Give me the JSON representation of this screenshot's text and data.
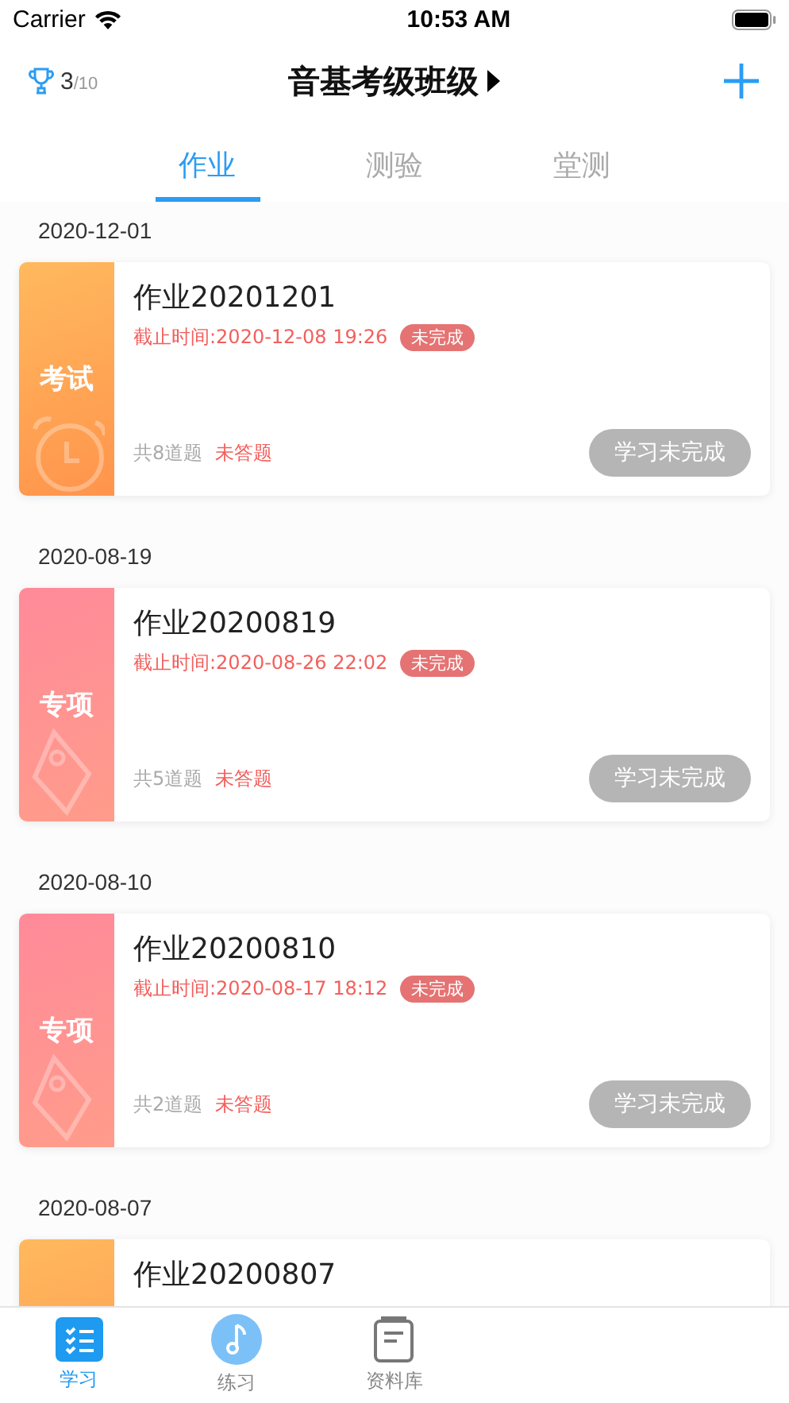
{
  "status_bar": {
    "carrier": "Carrier",
    "time": "10:53 AM"
  },
  "header": {
    "trophy_count": "3",
    "trophy_total": "/10",
    "title": "音基考级班级"
  },
  "tabs": [
    {
      "label": "作业",
      "selected": true
    },
    {
      "label": "测验",
      "selected": false
    },
    {
      "label": "堂测",
      "selected": false
    }
  ],
  "groups": [
    {
      "date": "2020-12-01",
      "card": {
        "kind": "exam",
        "tag": "考试",
        "title": "作业20201201",
        "deadline": "截止时间:2020-12-08 19:26",
        "status": "未完成",
        "count": "共8道题",
        "answer_state": "未答题",
        "action": "学习未完成"
      }
    },
    {
      "date": "2020-08-19",
      "card": {
        "kind": "special",
        "tag": "专项",
        "title": "作业20200819",
        "deadline": "截止时间:2020-08-26 22:02",
        "status": "未完成",
        "count": "共5道题",
        "answer_state": "未答题",
        "action": "学习未完成"
      }
    },
    {
      "date": "2020-08-10",
      "card": {
        "kind": "special",
        "tag": "专项",
        "title": "作业20200810",
        "deadline": "截止时间:2020-08-17 18:12",
        "status": "未完成",
        "count": "共2道题",
        "answer_state": "未答题",
        "action": "学习未完成"
      }
    },
    {
      "date": "2020-08-07",
      "card": {
        "kind": "exam",
        "title": "作业20200807"
      }
    }
  ],
  "bottom_tabs": [
    {
      "label": "学习",
      "kind": "list",
      "selected": true
    },
    {
      "label": "练习",
      "kind": "note",
      "selected": false
    },
    {
      "label": "资料库",
      "kind": "book",
      "selected": false
    }
  ]
}
